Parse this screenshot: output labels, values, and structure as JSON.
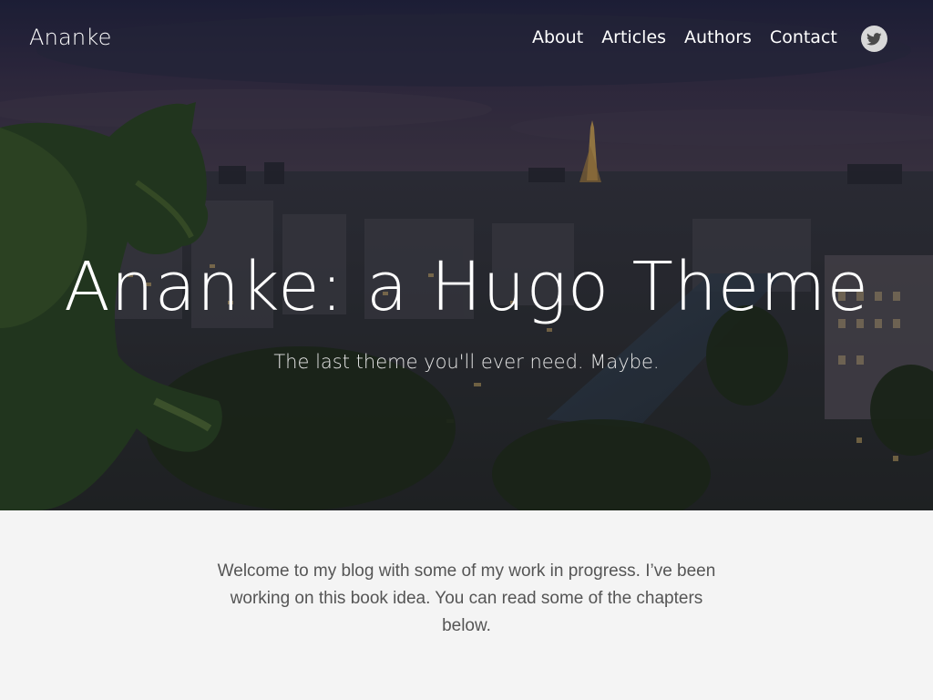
{
  "site": {
    "title": "Ananke"
  },
  "nav": {
    "items": [
      {
        "label": "About"
      },
      {
        "label": "Articles"
      },
      {
        "label": "Authors"
      },
      {
        "label": "Contact"
      }
    ],
    "social_icon": "twitter-icon"
  },
  "hero": {
    "title": "Ananke: a Hugo Theme",
    "subtitle": "The last theme you'll ever need. Maybe."
  },
  "intro": {
    "text": "Welcome to my blog with some of my work in progress. I’ve been working on this book idea. You can read some of the chapters below."
  },
  "colors": {
    "page_background": "#f4f4f4",
    "intro_text": "#555555",
    "nav_text": "#ffffff",
    "twitter_icon_bg": "#d8d8d8",
    "twitter_icon_fg": "#4a4a4a"
  }
}
